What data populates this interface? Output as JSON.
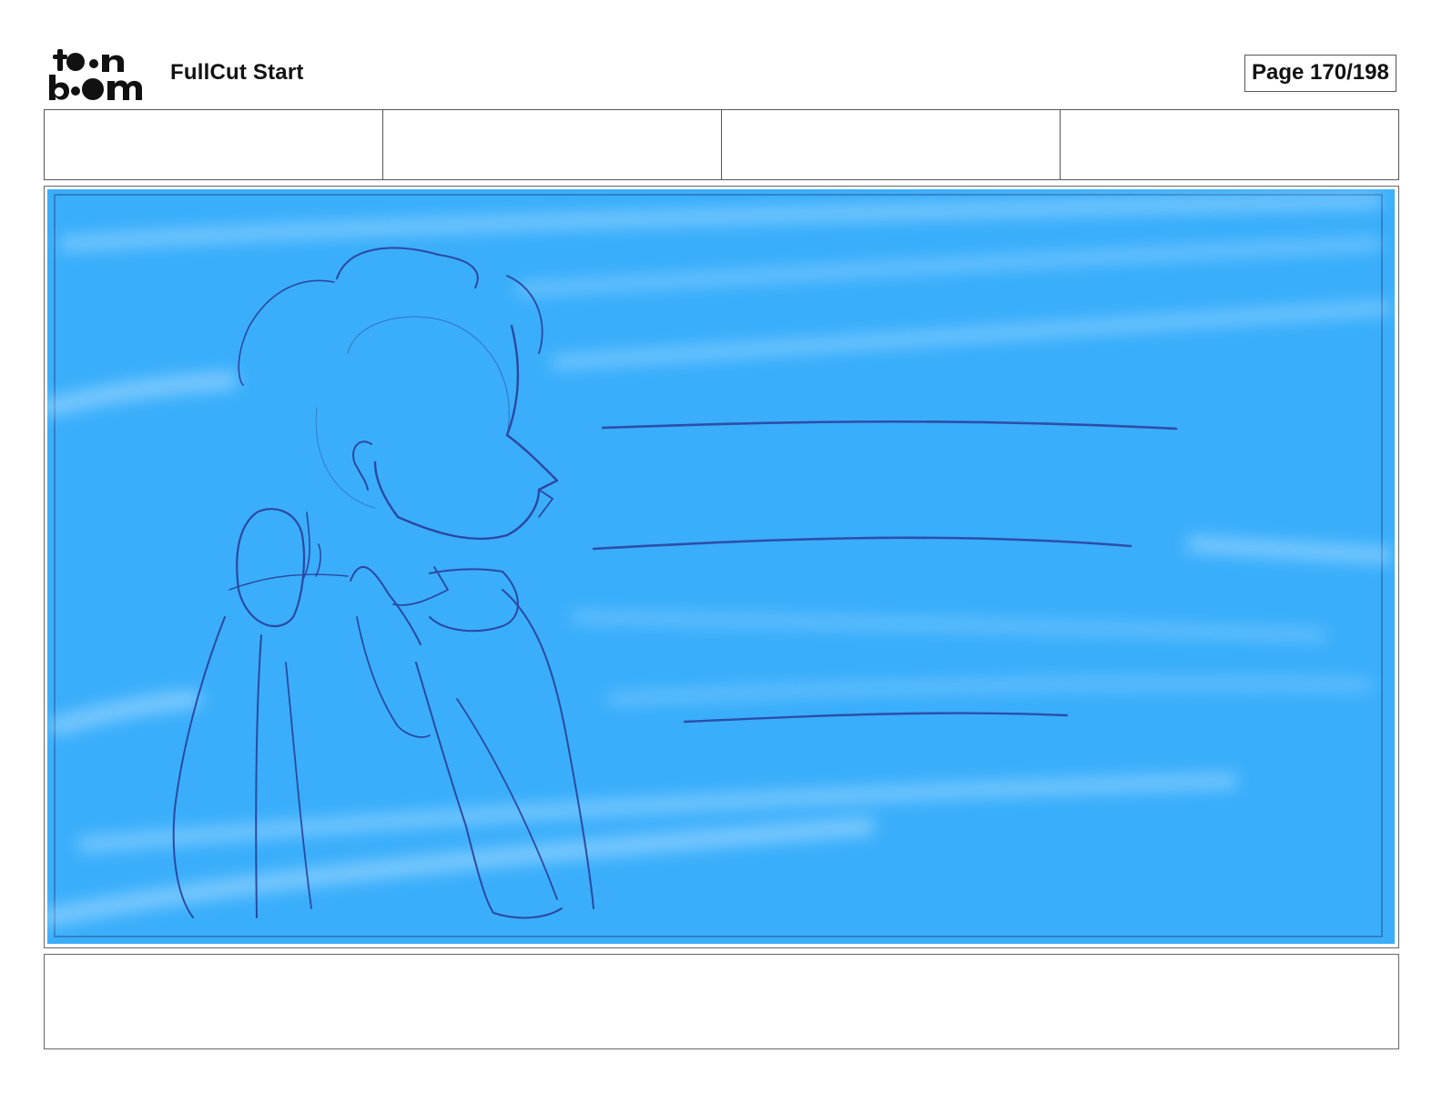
{
  "header": {
    "logo_alt": "toon boom",
    "project_title": "FullCut Start",
    "page_indicator": "Page 170/198"
  },
  "info_strip": {
    "cells": [
      "",
      "",
      "",
      ""
    ]
  },
  "panel": {
    "background_color": "#3aaefb",
    "sketch_color": "#2a3d9a"
  },
  "caption": {
    "text": ""
  }
}
